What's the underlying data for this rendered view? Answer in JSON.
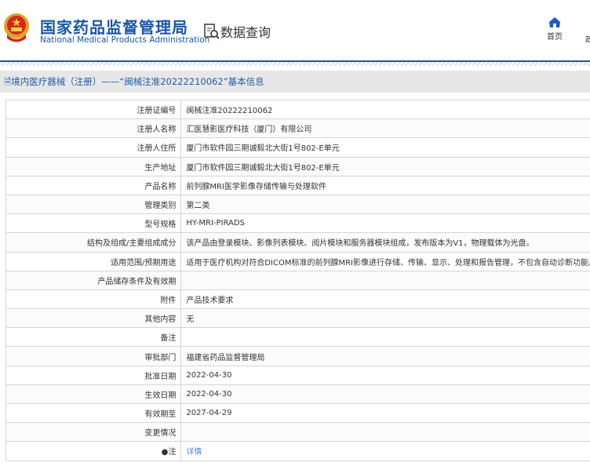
{
  "header": {
    "title_cn": "国家药品监督管理局",
    "title_en": "National Medical Products Administration",
    "section": "数据查询",
    "nav_home": "首页",
    "nav_next": "政"
  },
  "breadcrumb": "境内医疗器械（注册）——“闽械注准20222210062”基本信息",
  "rows": [
    {
      "label": "注册证编号",
      "value": "闽械注准20222210062"
    },
    {
      "label": "注册人名称",
      "value": "汇医慧影医疗科技（厦门）有限公司"
    },
    {
      "label": "注册人住所",
      "value": "厦门市软件园三期诚毅北大街1号802-E单元"
    },
    {
      "label": "生产地址",
      "value": "厦门市软件园三期诚毅北大街1号802-E单元"
    },
    {
      "label": "产品名称",
      "value": "前列腺MRI医学影像存储传输与处理软件"
    },
    {
      "label": "管理类别",
      "value": "第二类"
    },
    {
      "label": "型号规格",
      "value": "HY-MRI-PIRADS"
    },
    {
      "label": "结构及组成/主要组成成分",
      "value": "该产品由登录模块、影像列表模块、阅片模块和服务器模块组成，发布版本为V1，物理载体为光盘。"
    },
    {
      "label": "适用范围/预期用途",
      "value": "适用于医疗机构对符合DICOM标准的前列腺MRI影像进行存储、传输、显示、处理和报告管理，不包含自动诊断功能。"
    },
    {
      "label": "产品储存条件及有效期",
      "value": ""
    },
    {
      "label": "附件",
      "value": "产品技术要求"
    },
    {
      "label": "其他内容",
      "value": "无"
    },
    {
      "label": "备注",
      "value": ""
    },
    {
      "label": "审批部门",
      "value": "福建省药品监督管理局"
    },
    {
      "label": "批准日期",
      "value": "2022-04-30"
    },
    {
      "label": "生效日期",
      "value": "2022-04-30"
    },
    {
      "label": "有效期至",
      "value": "2027-04-29"
    },
    {
      "label": "变更情况",
      "value": ""
    }
  ],
  "note": {
    "label": "注",
    "link": "详情"
  }
}
